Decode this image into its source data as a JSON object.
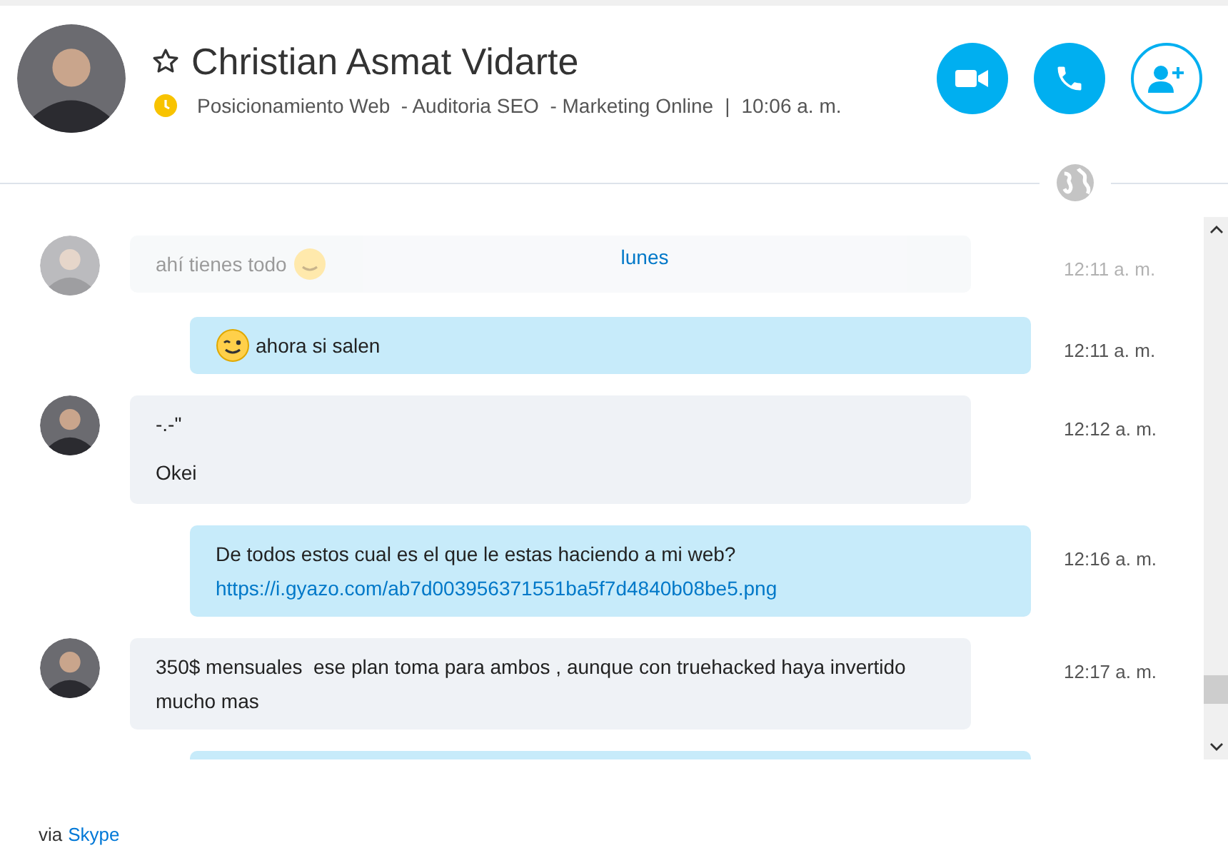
{
  "header": {
    "name": "Christian Asmat Vidarte",
    "favorite": false,
    "status": {
      "kind": "away"
    },
    "mood": "Posicionamiento Web  - Auditoria SEO  - Marketing Online",
    "separator": "|",
    "local_time": "10:06 a. m."
  },
  "day_label": "lunes",
  "messages": [
    {
      "kind": "incoming",
      "faded": true,
      "lines": [
        "ahí tienes todo"
      ],
      "emoticon": {
        "kind": "smile"
      },
      "time": "12:11 a. m."
    },
    {
      "kind": "outgoing",
      "faded": false,
      "lines": [
        "ahora si salen"
      ],
      "emoticon": {
        "kind": "wink"
      },
      "time": "12:11 a. m."
    },
    {
      "kind": "incoming",
      "faded": false,
      "lines": [
        "-.-\"",
        "Okei"
      ],
      "time": "12:12 a. m."
    },
    {
      "kind": "outgoing",
      "faded": false,
      "lines": [
        "De todos estos cual es el que le estas haciendo a mi web?"
      ],
      "link": "https://i.gyazo.com/ab7d003956371551ba5f7d4840b08be5.png",
      "time": "12:16 a. m."
    },
    {
      "kind": "incoming",
      "faded": false,
      "lines": [
        "350$ mensuales  ese plan toma para ambos , aunque con truehacked haya invertido mucho mas"
      ],
      "time": "12:17 a. m."
    }
  ],
  "footer": {
    "prefix": "via",
    "link": "Skype"
  }
}
